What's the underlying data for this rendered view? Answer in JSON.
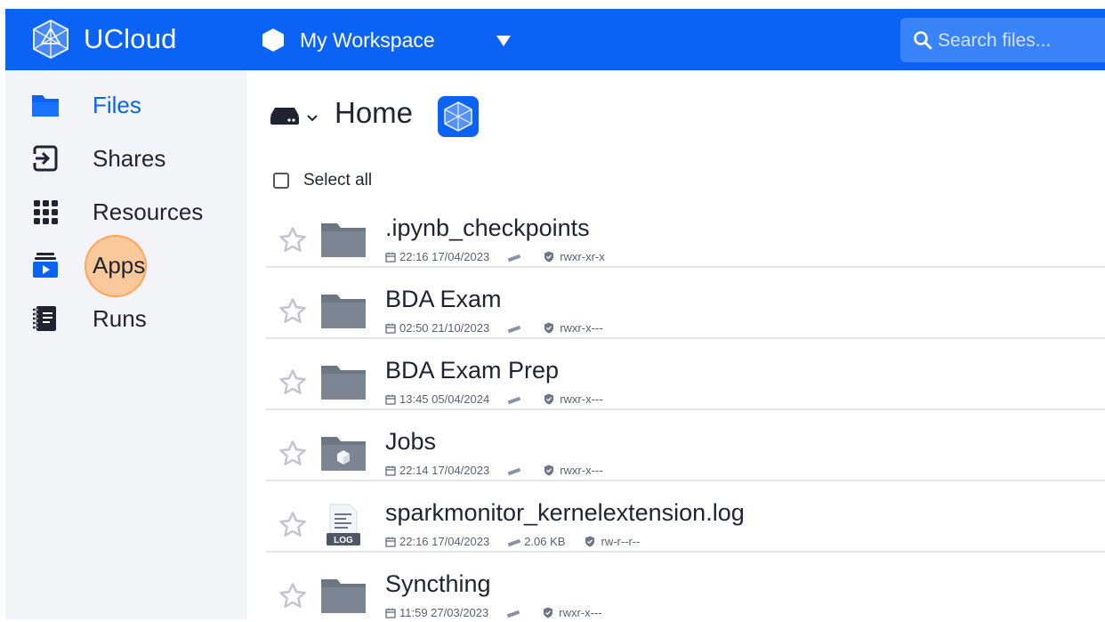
{
  "app": {
    "name": "UCloud"
  },
  "workspace": {
    "name": "My Workspace"
  },
  "search": {
    "placeholder": "Search files..."
  },
  "sidebar": {
    "items": [
      {
        "label": "Files",
        "icon": "folder-icon",
        "active": true
      },
      {
        "label": "Shares",
        "icon": "share-icon",
        "active": false
      },
      {
        "label": "Resources",
        "icon": "grid-icon",
        "active": false
      },
      {
        "label": "Apps",
        "icon": "apps-icon",
        "active": false
      },
      {
        "label": "Runs",
        "icon": "notebook-icon",
        "active": false
      }
    ]
  },
  "breadcrumb": {
    "title": "Home"
  },
  "select_all": {
    "label": "Select all"
  },
  "files": [
    {
      "name": ".ipynb_checkpoints",
      "type": "folder",
      "date": "22:16 17/04/2023",
      "size": "",
      "permissions": "rwxr-xr-x"
    },
    {
      "name": "BDA Exam",
      "type": "folder",
      "date": "02:50 21/10/2023",
      "size": "",
      "permissions": "rwxr-x---"
    },
    {
      "name": "BDA Exam Prep",
      "type": "folder",
      "date": "13:45 05/04/2024",
      "size": "",
      "permissions": "rwxr-x---"
    },
    {
      "name": "Jobs",
      "type": "jobs-folder",
      "date": "22:14 17/04/2023",
      "size": "",
      "permissions": "rwxr-x---"
    },
    {
      "name": "sparkmonitor_kernelextension.log",
      "type": "log",
      "date": "22:16 17/04/2023",
      "size": "2.06 KB",
      "permissions": "rw-r--r--"
    },
    {
      "name": "Syncthing",
      "type": "folder",
      "date": "11:59 27/03/2023",
      "size": "",
      "permissions": "rwxr-x---"
    }
  ],
  "colors": {
    "brand": "#0a63f5",
    "sidebar_bg": "#f2f4f8",
    "folder": "#6e7686",
    "click_highlight": "#ffa550"
  }
}
